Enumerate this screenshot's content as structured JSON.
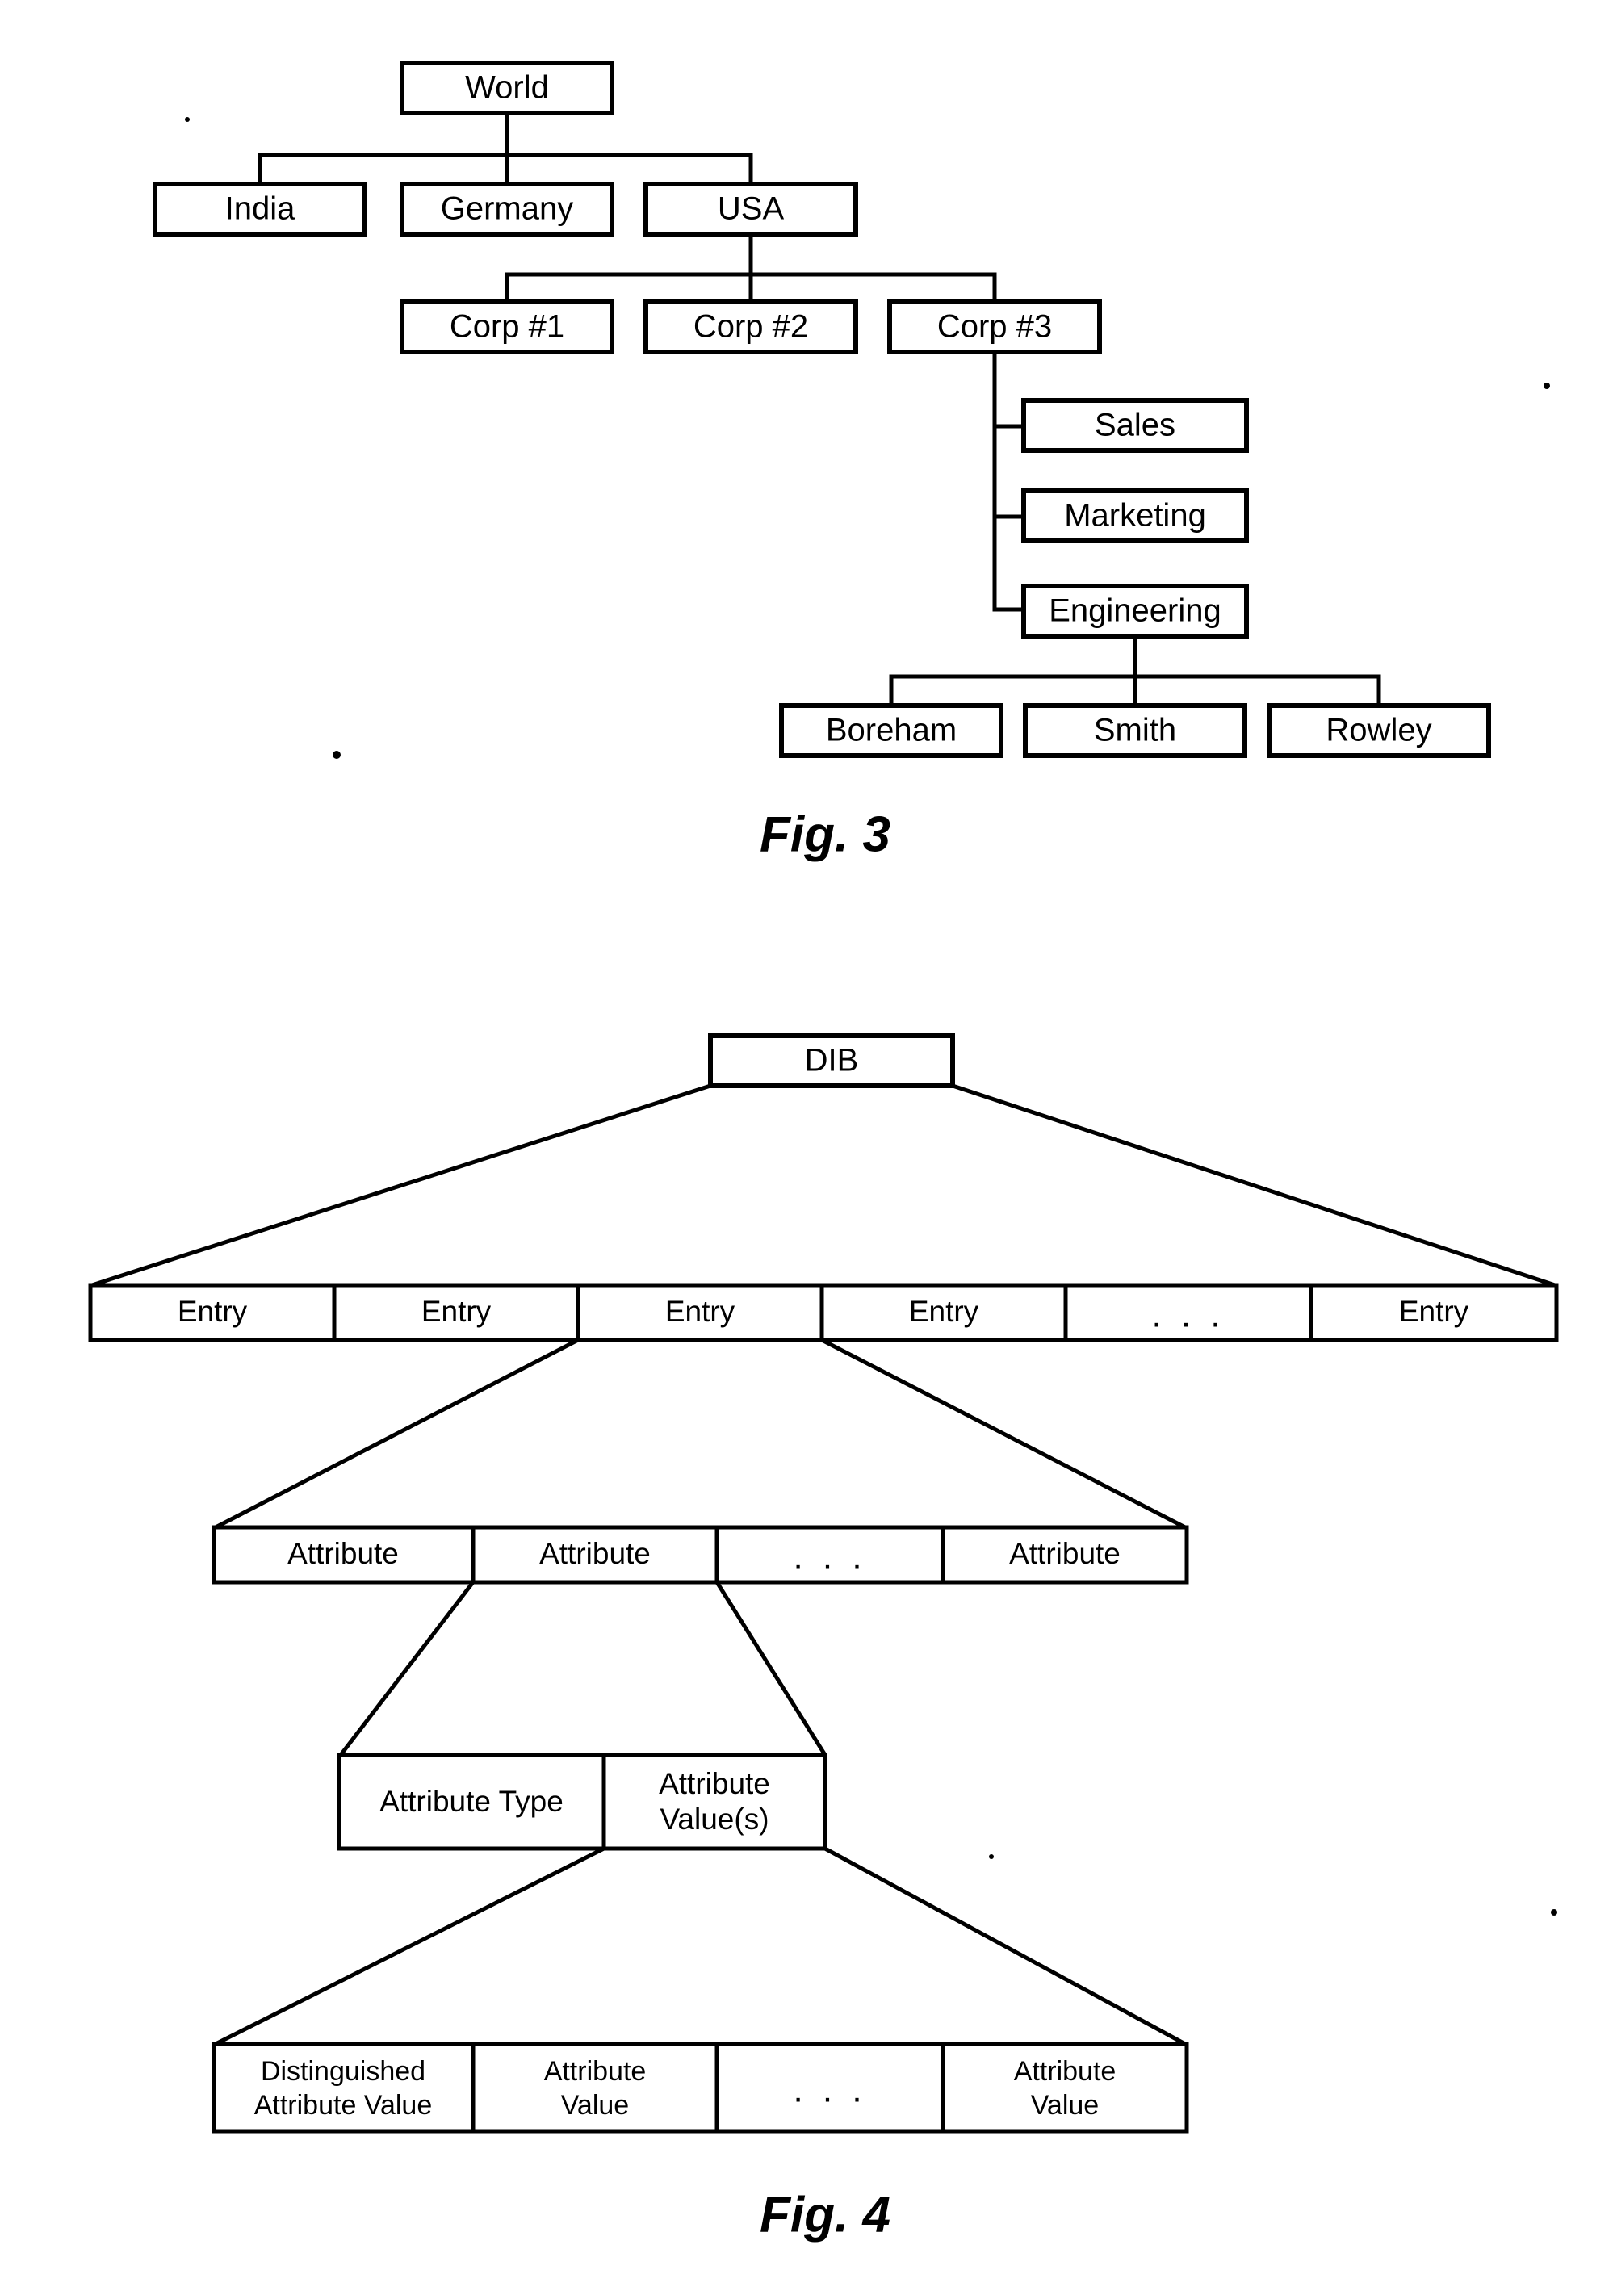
{
  "sheet": {
    "background_color": "#ffffff",
    "ink_color": "#000000"
  },
  "figure3": {
    "caption": "Fig. 3",
    "type": "hierarchical-tree-diagram",
    "nodes": {
      "root": "World",
      "level2": [
        "India",
        "Germany",
        "USA"
      ],
      "level3": [
        "Corp #1",
        "Corp #2",
        "Corp #3"
      ],
      "level4": [
        "Sales",
        "Marketing",
        "Engineering"
      ],
      "level5": [
        "Boreham",
        "Smith",
        "Rowley"
      ]
    },
    "edges": [
      "World -> India",
      "World -> Germany",
      "World -> USA",
      "USA -> Corp #1",
      "USA -> Corp #2",
      "USA -> Corp #3",
      "Corp #3 -> Sales",
      "Corp #3 -> Marketing",
      "Corp #3 -> Engineering",
      "Engineering -> Boreham",
      "Engineering -> Smith",
      "Engineering -> Rowley"
    ],
    "labels": {
      "world": "World",
      "india": "India",
      "germany": "Germany",
      "usa": "USA",
      "corp1": "Corp #1",
      "corp2": "Corp #2",
      "corp3": "Corp #3",
      "sales": "Sales",
      "marketing": "Marketing",
      "engineering": "Engineering",
      "boreham": "Boreham",
      "smith": "Smith",
      "rowley": "Rowley"
    }
  },
  "figure4": {
    "caption": "Fig. 4",
    "type": "hierarchical-decomposition-diagram",
    "root": "DIB",
    "ellipsis": ". . .",
    "rows": {
      "entry_row": {
        "name": "entry-row",
        "cells": [
          "Entry",
          "Entry",
          "Entry",
          "Entry",
          ". . .",
          "Entry"
        ]
      },
      "attribute_row": {
        "name": "attribute-row",
        "cells": [
          "Attribute",
          "Attribute",
          ". . .",
          "Attribute"
        ]
      },
      "attribute_detail_row": {
        "name": "attribute-detail-row",
        "cells": [
          "Attribute Type",
          "Attribute Value(s)"
        ],
        "cell_lines": [
          [
            "Attribute Type"
          ],
          [
            "Attribute",
            "Value(s)"
          ]
        ]
      },
      "value_row": {
        "name": "attribute-value-row",
        "cells": [
          "Distinguished Attribute Value",
          "Attribute Value",
          ". . .",
          "Attribute Value"
        ],
        "cell_lines": [
          [
            "Distinguished",
            "Attribute Value"
          ],
          [
            "Attribute",
            "Value"
          ],
          [
            ". . ."
          ],
          [
            "Attribute",
            "Value"
          ]
        ]
      }
    },
    "labels": {
      "dib": "DIB",
      "entry": "Entry",
      "attribute": "Attribute",
      "attribute_type": "Attribute Type",
      "attribute_value_s_line1": "Attribute",
      "attribute_value_s_line2": "Value(s)",
      "distinguished_line1": "Distinguished",
      "distinguished_line2": "Attribute Value",
      "attribute_value_line1": "Attribute",
      "attribute_value_line2": "Value"
    }
  }
}
